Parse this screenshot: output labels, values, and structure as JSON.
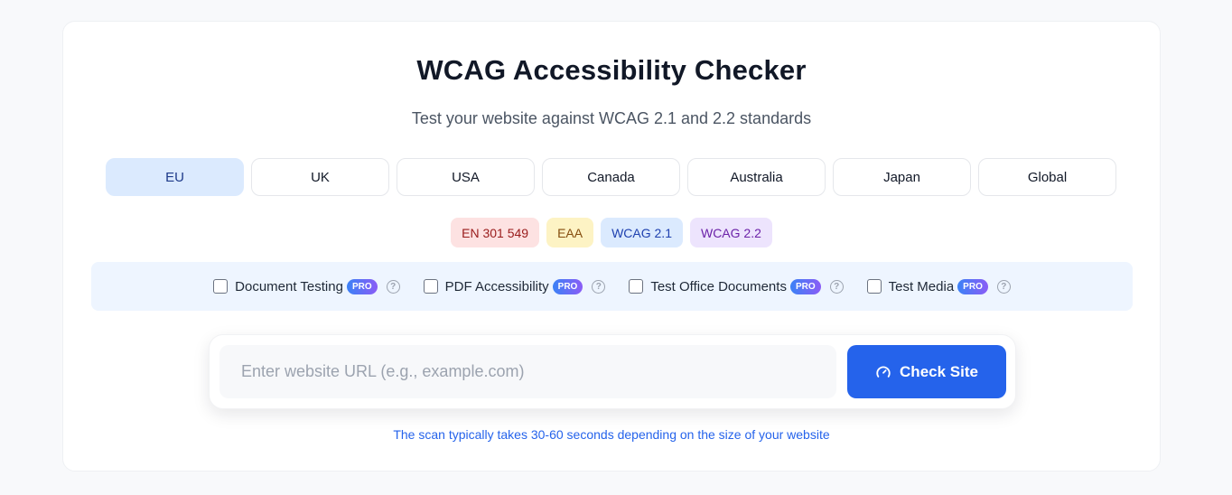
{
  "header": {
    "title": "WCAG Accessibility Checker",
    "subtitle": "Test your website against WCAG 2.1 and 2.2 standards"
  },
  "regions": {
    "active": "EU",
    "items": [
      {
        "label": "EU"
      },
      {
        "label": "UK"
      },
      {
        "label": "USA"
      },
      {
        "label": "Canada"
      },
      {
        "label": "Australia"
      },
      {
        "label": "Japan"
      },
      {
        "label": "Global"
      }
    ]
  },
  "standards": [
    {
      "label": "EN 301 549",
      "bg": "#fde2e2",
      "fg": "#991b1b"
    },
    {
      "label": "EAA",
      "bg": "#fdf3c4",
      "fg": "#854d0e"
    },
    {
      "label": "WCAG 2.1",
      "bg": "#dbeafe",
      "fg": "#1e40af"
    },
    {
      "label": "WCAG 2.2",
      "bg": "#ede4fd",
      "fg": "#6b21a8"
    }
  ],
  "options": [
    {
      "label": "Document Testing",
      "badge": "PRO",
      "checked": false
    },
    {
      "label": "PDF Accessibility",
      "badge": "PRO",
      "checked": false
    },
    {
      "label": "Test Office Documents",
      "badge": "PRO",
      "checked": false
    },
    {
      "label": "Test Media",
      "badge": "PRO",
      "checked": false
    }
  ],
  "search": {
    "placeholder": "Enter website URL (e.g., example.com)",
    "value": "",
    "button_label": "Check Site",
    "button_icon": "gauge-icon"
  },
  "hint": "The scan typically takes 30-60 seconds depending on the size of your website",
  "colors": {
    "accent": "#2563eb",
    "active_tab_bg": "#dbeafe",
    "options_bg": "#eef5ff"
  }
}
